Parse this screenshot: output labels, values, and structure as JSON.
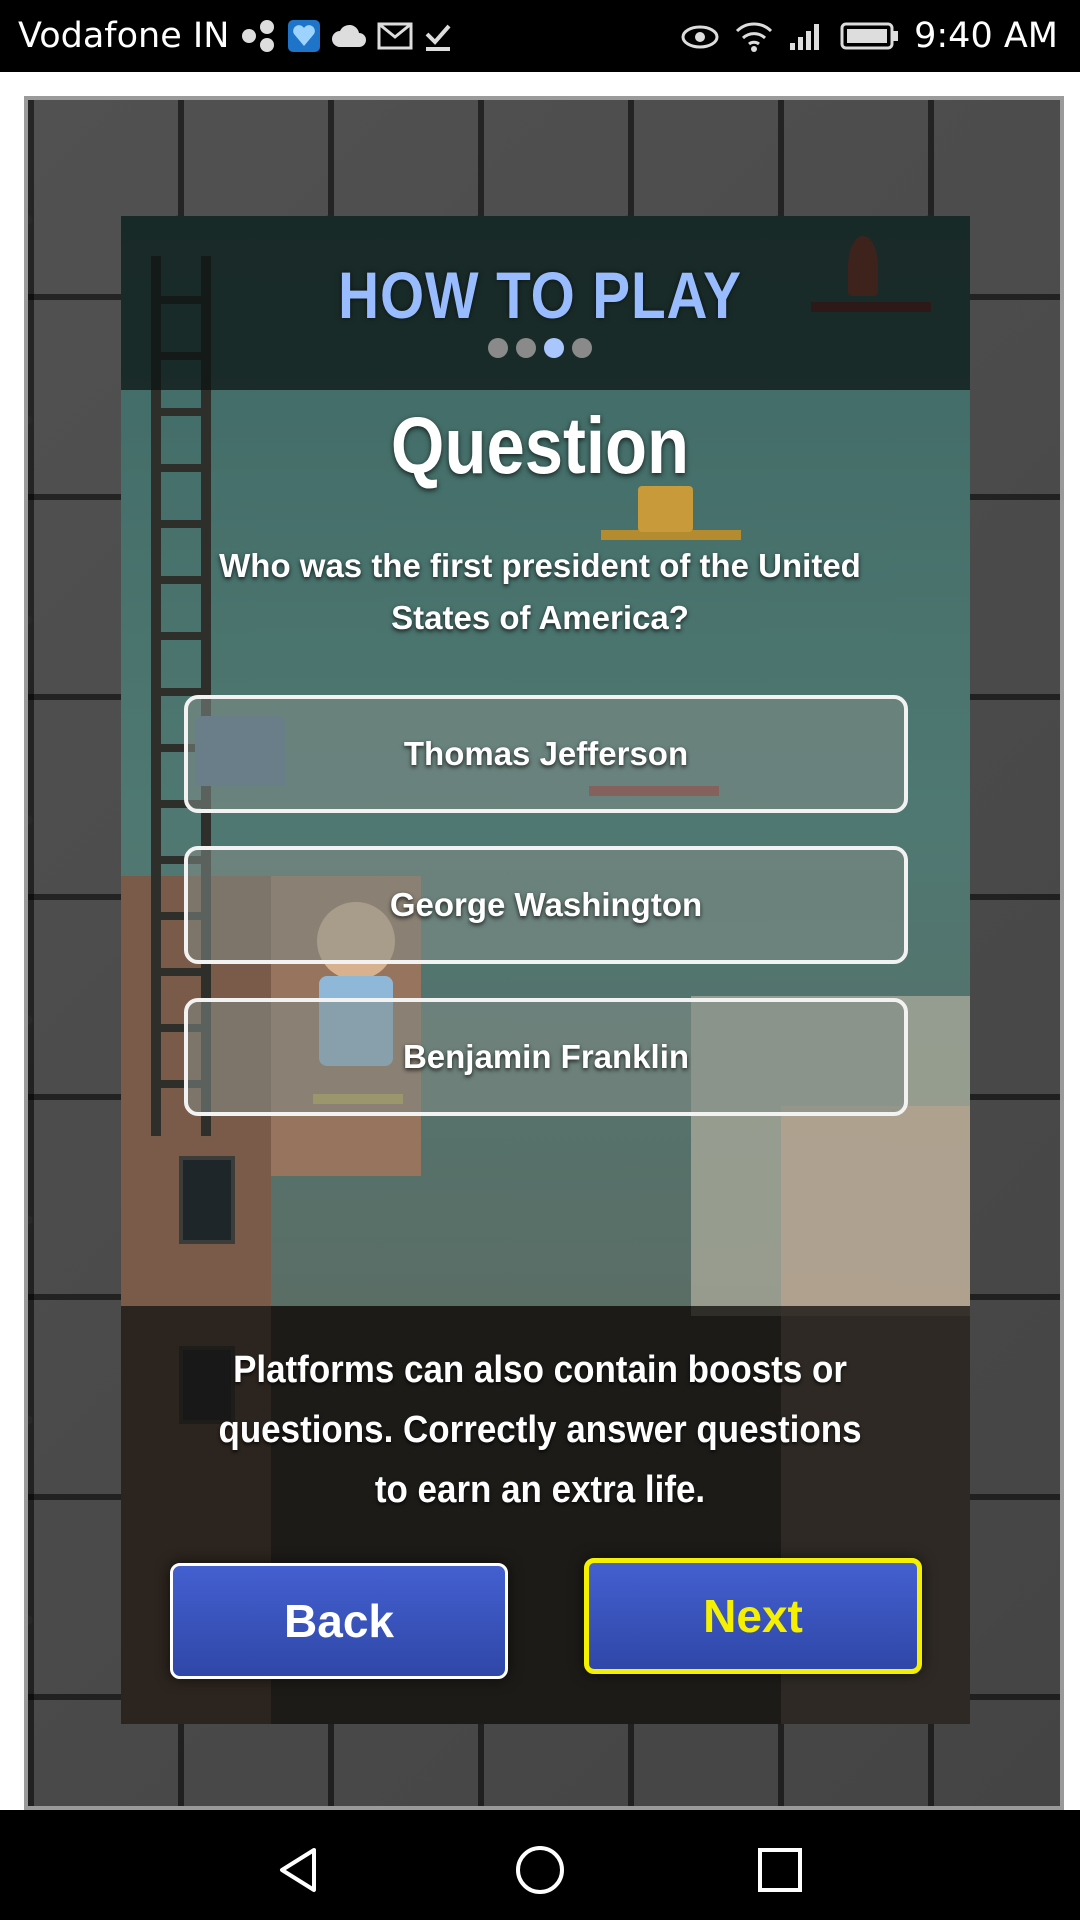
{
  "status_bar": {
    "carrier": "Vodafone IN",
    "time": "9:40 AM",
    "left_icons": [
      "share-network-icon",
      "health-app-icon",
      "cloud-icon",
      "mail-icon",
      "download-done-icon"
    ],
    "right_icons": [
      "eye-icon",
      "wifi-icon",
      "signal-icon",
      "battery-icon"
    ]
  },
  "game": {
    "title": "HOW TO PLAY",
    "page_indicator": {
      "total": 4,
      "current": 3
    },
    "question": {
      "heading": "Question",
      "text": "Who was the first president of the United States of America?",
      "answers": [
        "Thomas Jefferson",
        "George Washington",
        "Benjamin Franklin"
      ]
    },
    "info": "Platforms can also contain boosts or questions. Correctly answer questions to earn an extra life.",
    "buttons": {
      "back": "Back",
      "next": "Next"
    }
  },
  "colors": {
    "title": "#98bcff",
    "button": "#3a54bc",
    "next_accent": "#f5f000"
  },
  "navigation_bar": {
    "buttons": [
      "back-triangle-icon",
      "home-circle-icon",
      "recents-square-icon"
    ]
  }
}
